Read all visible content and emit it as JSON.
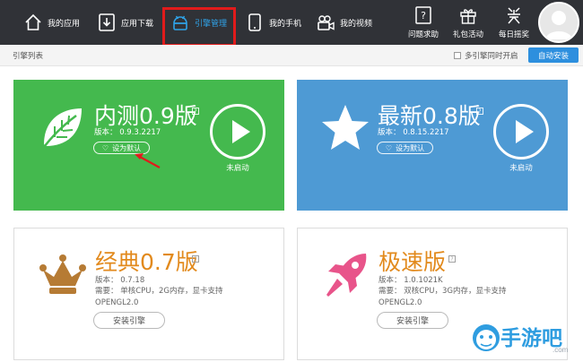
{
  "nav": {
    "items": [
      {
        "label": "我的应用",
        "icon": "home-icon"
      },
      {
        "label": "应用下载",
        "icon": "download-icon"
      },
      {
        "label": "引擎管理",
        "icon": "android-icon"
      },
      {
        "label": "我的手机",
        "icon": "phone-icon"
      },
      {
        "label": "我的视频",
        "icon": "video-icon"
      }
    ],
    "right": [
      {
        "label": "问题求助",
        "icon": "help-icon"
      },
      {
        "label": "礼包活动",
        "icon": "gift-icon"
      },
      {
        "label": "每日摇奖",
        "icon": "lottery-icon"
      }
    ],
    "active_color": "#2fa3e8",
    "highlight_color": "#e01b1b"
  },
  "subbar": {
    "title": "引擎列表",
    "multi_label": "多引擎同时开启",
    "auto_install": "自动安装"
  },
  "engines": [
    {
      "title": "内测0.9版",
      "version": "版本：  0.9.3.2217",
      "default_label": "设为默认",
      "status": "未启动",
      "color": "#44b94e",
      "icon": "leaf-icon"
    },
    {
      "title": "最新0.8版",
      "version": "版本：  0.8.15.2217",
      "default_label": "设为默认",
      "status": "未启动",
      "color": "#4e9ad4",
      "icon": "star-icon"
    },
    {
      "title": "经典0.7版",
      "version": "版本：  0.7.18",
      "req1": "需要：  单核CPU，2G内存，显卡支持",
      "req2": "OPENGL2.0",
      "install_label": "安装引擎",
      "icon": "crown-icon"
    },
    {
      "title": "极速版",
      "version": "版本：  1.0.1021K",
      "req1": "需要：  双核CPU，3G内存，显卡支持",
      "req2": "OPENGL2.0",
      "install_label": "安装引擎",
      "icon": "rocket-icon"
    }
  ],
  "help_mark": "?",
  "watermark": {
    "text": "手游吧",
    "sub": ".com"
  }
}
